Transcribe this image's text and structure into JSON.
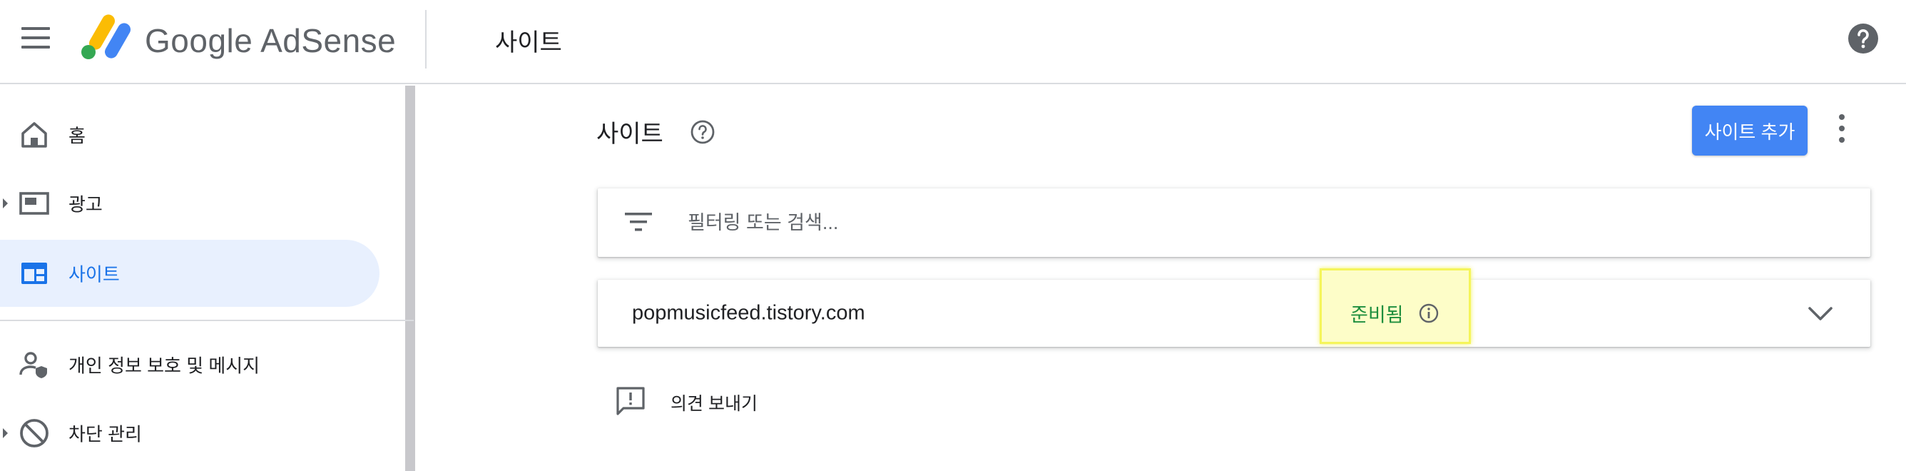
{
  "app": {
    "logo_text": "Google AdSense",
    "page_heading": "사이트"
  },
  "icons": {
    "menu": "hamburger-menu-icon",
    "help": "help-circle-icon",
    "home": "home-icon",
    "ads": "ad-unit-icon",
    "sites": "sites-icon",
    "privacy": "person-shield-icon",
    "blocking": "block-icon",
    "filter": "filter-list-icon",
    "info": "info-outline-icon",
    "expand": "chevron-down-icon",
    "feedback": "feedback-icon",
    "more": "more-vert-icon"
  },
  "sidebar": {
    "items": [
      {
        "label": "홈",
        "expandable": false,
        "active": false
      },
      {
        "label": "광고",
        "expandable": true,
        "active": false
      },
      {
        "label": "사이트",
        "expandable": false,
        "active": true
      },
      {
        "label": "개인 정보 보호 및 메시지",
        "expandable": false,
        "active": false
      },
      {
        "label": "차단 관리",
        "expandable": true,
        "active": false
      }
    ]
  },
  "main": {
    "title": "사이트",
    "add_site_label": "사이트 추가",
    "filter": {
      "placeholder": "필터링 또는 검색..."
    },
    "sites": [
      {
        "domain": "popmusicfeed.tistory.com",
        "status": "준비됨"
      }
    ],
    "feedback_label": "의견 보내기"
  },
  "colors": {
    "accent_blue": "#4285f4",
    "active_blue": "#1a73e8",
    "active_bg": "#e8f0fe",
    "status_green": "#1e8e3e",
    "highlight_yellow": "#f5f55a"
  }
}
